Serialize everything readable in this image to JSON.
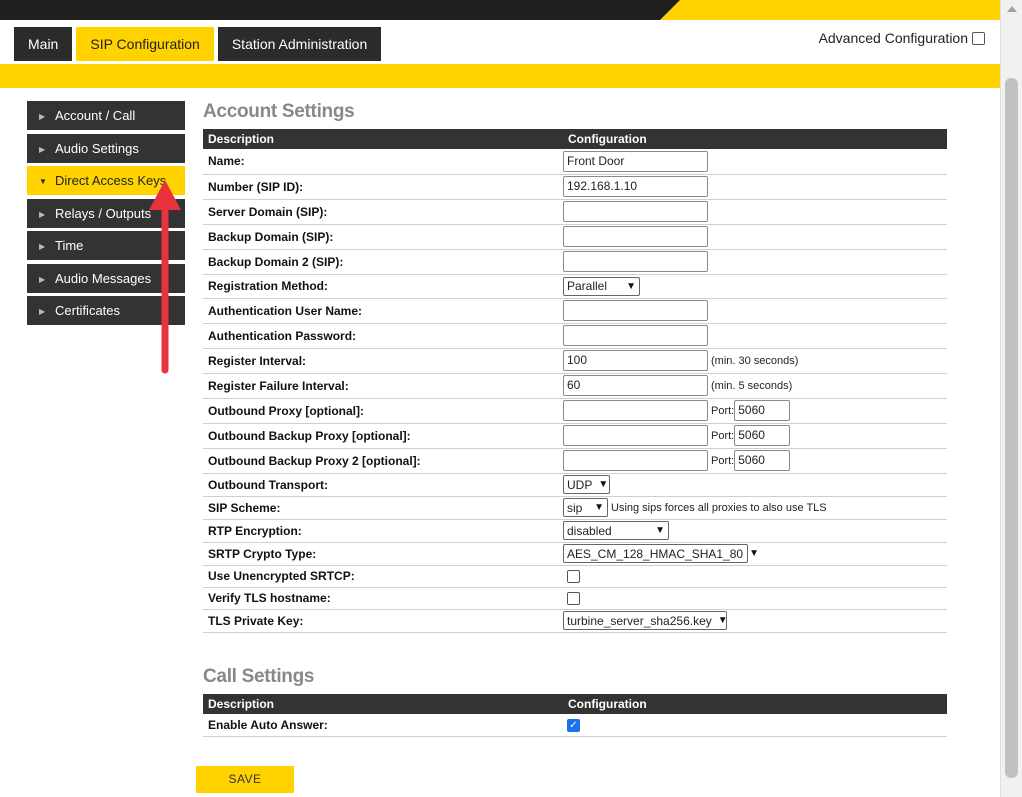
{
  "tabs": {
    "main": "Main",
    "sip": "SIP Configuration",
    "station": "Station Administration"
  },
  "advanced": {
    "label": "Advanced Configuration",
    "checked": false
  },
  "sidebar": {
    "items": [
      {
        "label": "Account / Call"
      },
      {
        "label": "Audio Settings"
      },
      {
        "label": "Direct Access Keys"
      },
      {
        "label": "Relays / Outputs"
      },
      {
        "label": "Time"
      },
      {
        "label": "Audio Messages"
      },
      {
        "label": "Certificates"
      }
    ],
    "active": "Direct Access Keys"
  },
  "account": {
    "title": "Account Settings",
    "col_desc": "Description",
    "col_cfg": "Configuration",
    "name_label": "Name:",
    "name_value": "Front Door",
    "number_label": "Number (SIP ID):",
    "number_value": "192.168.1.10",
    "server_label": "Server Domain (SIP):",
    "server_value": "",
    "backup_label": "Backup Domain (SIP):",
    "backup_value": "",
    "backup2_label": "Backup Domain 2 (SIP):",
    "backup2_value": "",
    "regmethod_label": "Registration Method:",
    "regmethod_value": "Parallel",
    "authuser_label": "Authentication User Name:",
    "authuser_value": "",
    "authpass_label": "Authentication Password:",
    "authpass_value": "",
    "reginterval_label": "Register Interval:",
    "reginterval_value": "100",
    "reginterval_note": "(min. 30 seconds)",
    "regfail_label": "Register Failure Interval:",
    "regfail_value": "60",
    "regfail_note": "(min. 5 seconds)",
    "proxy_label": "Outbound Proxy [optional]:",
    "proxy_value": "",
    "port_label": "Port:",
    "proxy_port": "5060",
    "bproxy_label": "Outbound Backup Proxy [optional]:",
    "bproxy_value": "",
    "bproxy_port": "5060",
    "bproxy2_label": "Outbound Backup Proxy 2 [optional]:",
    "bproxy2_value": "",
    "bproxy2_port": "5060",
    "transport_label": "Outbound Transport:",
    "transport_value": "UDP",
    "scheme_label": "SIP Scheme:",
    "scheme_value": "sip",
    "scheme_note": "Using sips forces all proxies to also use TLS",
    "rtp_label": "RTP Encryption:",
    "rtp_value": "disabled",
    "srtp_label": "SRTP Crypto Type:",
    "srtp_value": "AES_CM_128_HMAC_SHA1_80",
    "srtcp_label": "Use Unencrypted SRTCP:",
    "srtcp_checked": false,
    "verifytls_label": "Verify TLS hostname:",
    "verifytls_checked": false,
    "tlskey_label": "TLS Private Key:",
    "tlskey_value": "turbine_server_sha256.key"
  },
  "call": {
    "title": "Call Settings",
    "col_desc": "Description",
    "col_cfg": "Configuration",
    "autoanswer_label": "Enable Auto Answer:",
    "autoanswer_checked": true
  },
  "save_label": "SAVE",
  "colors": {
    "accent": "#ffd200",
    "dark": "#333333",
    "annotation": "#e8333f"
  }
}
